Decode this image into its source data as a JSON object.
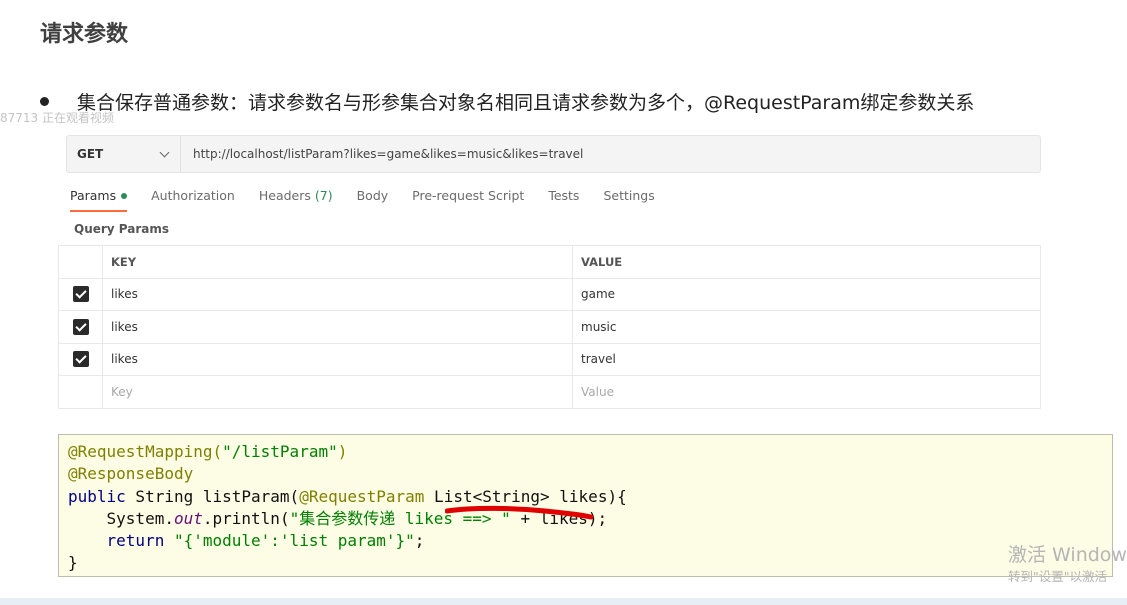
{
  "slide": {
    "title": "请求参数",
    "bullet_text": "集合保存普通参数：请求参数名与形参集合对象名相同且请求参数为多个，@RequestParam绑定参数关系",
    "watermark_text": "87713 正在观看视频"
  },
  "request": {
    "method": "GET",
    "url": "http://localhost/listParam?likes=game&likes=music&likes=travel"
  },
  "tabs": [
    {
      "label": "Params",
      "active": true
    },
    {
      "label": "Authorization"
    },
    {
      "label": "Headers",
      "count": "(7)"
    },
    {
      "label": "Body"
    },
    {
      "label": "Pre-request Script"
    },
    {
      "label": "Tests"
    },
    {
      "label": "Settings"
    }
  ],
  "query_params": {
    "section_label": "Query Params",
    "columns": {
      "key": "KEY",
      "value": "VALUE"
    },
    "rows": [
      {
        "key": "likes",
        "value": "game",
        "checked": true
      },
      {
        "key": "likes",
        "value": "music",
        "checked": true
      },
      {
        "key": "likes",
        "value": "travel",
        "checked": true
      }
    ],
    "placeholder_key": "Key",
    "placeholder_value": "Value"
  },
  "code": {
    "line1_annotation": "@RequestMapping(",
    "line1_string": "\"/listParam\"",
    "line1_end": ")",
    "line2_annotation": "@ResponseBody",
    "line3_kw": "public",
    "line3_mid": " String listParam(",
    "line3_annotation": "@RequestParam",
    "line3_end": " List<String> likes){",
    "line4_start": "    System.",
    "line4_field": "out",
    "line4_mid": ".println(",
    "line4_string": "\"集合参数传递 likes ==> \"",
    "line4_end": " + likes);",
    "line5_kw": "    return",
    "line5_string": " \"{'module':'list param'}\"",
    "line5_end": ";",
    "line6": "}"
  },
  "overlay": {
    "activation_title": "激活 Windows",
    "activation_sub": "转到\"设置\"以激活"
  },
  "colors": {
    "active_tab_underline": "#ff6c37",
    "status_green": "#2e8b57",
    "code_background": "#fdfce5",
    "annotation_red": "#e00000"
  }
}
